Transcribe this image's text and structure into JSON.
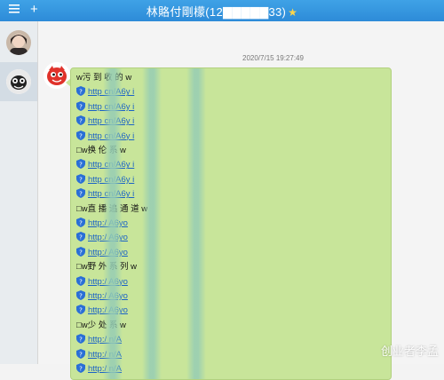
{
  "window": {
    "add_label": "+",
    "title": "林賂付剛檬(12▇▇▇▇▇33)",
    "star_icon": "star-icon"
  },
  "sidebar": {
    "items": [
      {
        "name": "contact-photo-avatar",
        "active": false
      },
      {
        "name": "contact-cartoon-avatar",
        "active": true
      }
    ]
  },
  "chat": {
    "timestamp": "2020/7/15 19:27:49",
    "message_lines": [
      {
        "type": "text",
        "text": "w污 到    收 的  w"
      },
      {
        "type": "link",
        "text": "http    cn/A6y   i"
      },
      {
        "type": "link",
        "text": "http    cn/A6y   i"
      },
      {
        "type": "link",
        "text": "http    cn/A6y   i"
      },
      {
        "type": "link",
        "text": "http    cn/A6y   i"
      },
      {
        "type": "text",
        "text": "□w换     伦 系    w"
      },
      {
        "type": "link",
        "text": "http    cn/A6y   i"
      },
      {
        "type": "link",
        "text": "http    cn/A6y   i"
      },
      {
        "type": "link",
        "text": "http    cn/A6y   i"
      },
      {
        "type": "text",
        "text": "□w直 播    追 通 道   w"
      },
      {
        "type": "link",
        "text": "http:/     A6yo"
      },
      {
        "type": "link",
        "text": "http:/     A6yo"
      },
      {
        "type": "link",
        "text": "http:/     A6yo"
      },
      {
        "type": "text",
        "text": "□w野 外     系 列    w"
      },
      {
        "type": "link",
        "text": "http:/     A6yo"
      },
      {
        "type": "link",
        "text": "http:/     A6yo"
      },
      {
        "type": "link",
        "text": "http:/     A6yo"
      },
      {
        "type": "text",
        "text": "□w少      处 系      w"
      },
      {
        "type": "link",
        "text": "http:/     n/A"
      },
      {
        "type": "link",
        "text": "http:/     n/A"
      },
      {
        "type": "link",
        "text": "http:/     n/A"
      }
    ]
  },
  "watermark": "创业者李孟",
  "colors": {
    "titlebar": "#2d8bd8",
    "bubble": "#c8e59a",
    "link": "#1a62c6",
    "shield": "#2a6fd6"
  }
}
